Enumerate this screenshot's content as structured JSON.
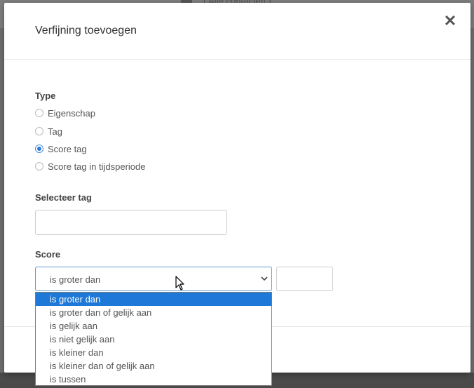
{
  "backdrop": {
    "header_text": "( Alle contacten )"
  },
  "modal": {
    "title": "Verfijning toevoegen",
    "close_icon": "close-icon"
  },
  "type_section": {
    "label": "Type",
    "options": [
      {
        "label": "Eigenschap",
        "checked": false
      },
      {
        "label": "Tag",
        "checked": false
      },
      {
        "label": "Score tag",
        "checked": true
      },
      {
        "label": "Score tag in tijdsperiode",
        "checked": false
      }
    ]
  },
  "tag_section": {
    "label": "Selecteer tag",
    "value": ""
  },
  "score_section": {
    "label": "Score",
    "selected": "is groter dan",
    "value": "",
    "options": [
      "is groter dan",
      "is groter dan of gelijk aan",
      "is gelijk aan",
      "is niet gelijk aan",
      "is kleiner dan",
      "is kleiner dan of gelijk aan",
      "is tussen"
    ]
  },
  "colors": {
    "accent": "#1e78d7",
    "select_border": "#5b9bd5"
  }
}
